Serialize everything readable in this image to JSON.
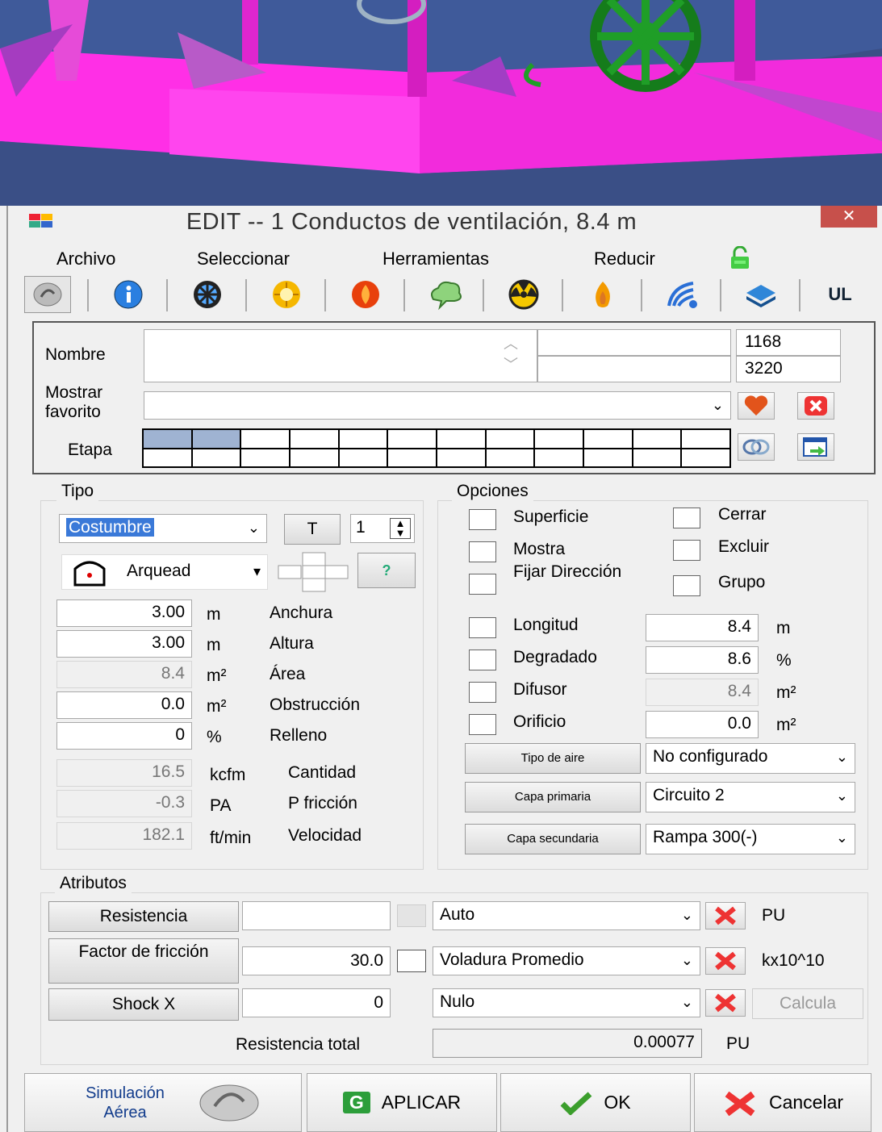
{
  "window": {
    "title": "EDIT -- 1 Conductos de ventilación, 8.4 m",
    "close": "✕"
  },
  "menu": [
    "Archivo",
    "Seleccionar",
    "Herramientas",
    "Reducir"
  ],
  "toolbar_icons": [
    "simulacion-icon",
    "info-icon",
    "fan-icon",
    "sun-icon",
    "fire-icon",
    "cloud-icon",
    "radiation-icon",
    "flame-icon",
    "signal-icon",
    "layers-icon",
    "ul-icon"
  ],
  "toolbar_ul": "UL",
  "header": {
    "nombre_label": "Nombre",
    "nombre_value": "",
    "id1": "1168",
    "id2": "3220",
    "favorito_label": "Mostrar favorito",
    "favorito_value": "",
    "etapa_label": "Etapa",
    "etapa_cells": 12,
    "etapa_selected": 2
  },
  "tipo": {
    "legend": "Tipo",
    "type_value": "Costumbre",
    "t_button": "T",
    "spinner_value": "1",
    "shape_value": "Arquead",
    "help": "?",
    "rows": [
      {
        "value": "3.00",
        "unit": "m",
        "label": "Anchura",
        "editable": true
      },
      {
        "value": "3.00",
        "unit": "m",
        "label": "Altura",
        "editable": true
      },
      {
        "value": "8.4",
        "unit": "m²",
        "label": "Área",
        "editable": false
      },
      {
        "value": "0.0",
        "unit": "m²",
        "label": "Obstrucción",
        "editable": true
      },
      {
        "value": "0",
        "unit": "%",
        "label": "Relleno",
        "editable": true
      }
    ],
    "calc": [
      {
        "value": "16.5",
        "unit": "kcfm",
        "label": "Cantidad"
      },
      {
        "value": "-0.3",
        "unit": "PA",
        "label": "P fricción"
      },
      {
        "value": "182.1",
        "unit": "ft/min",
        "label": "Velocidad"
      }
    ]
  },
  "opciones": {
    "legend": "Opciones",
    "checks_left": [
      "Superficie",
      "Mostra",
      "Fijar Dirección"
    ],
    "checks_right": [
      "Cerrar",
      "Excluir",
      "Grupo"
    ],
    "rows": [
      {
        "label": "Longitud",
        "value": "8.4",
        "unit": "m",
        "editable": true
      },
      {
        "label": "Degradado",
        "value": "8.6",
        "unit": "%",
        "editable": true
      },
      {
        "label": "Difusor",
        "value": "8.4",
        "unit": "m²",
        "editable": false
      },
      {
        "label": "Orificio",
        "value": "0.0",
        "unit": "m²",
        "editable": true
      }
    ],
    "combos": [
      {
        "button": "Tipo de aire",
        "value": "No configurado"
      },
      {
        "button": "Capa primaria",
        "value": "Circuito 2"
      },
      {
        "button": "Capa secundaria",
        "value": "Rampa 300(-)"
      }
    ]
  },
  "atributos": {
    "legend": "Atributos",
    "rows": [
      {
        "button": "Resistencia",
        "value": "",
        "combo": "Auto",
        "unit": "PU"
      },
      {
        "button": "Factor de fricción",
        "value": "30.0",
        "combo": "Voladura Promedio",
        "unit": "kx10^10"
      },
      {
        "button": "Shock X",
        "value": "0",
        "combo": "Nulo",
        "unit": ""
      }
    ],
    "calcula": "Calcula",
    "total_label": "Resistencia total",
    "total_value": "0.00077",
    "total_unit": "PU"
  },
  "footer": {
    "sim_label": "Simulación Aérea",
    "aplicar": "APLICAR",
    "ok": "OK",
    "cancelar": "Cancelar",
    "aplicar_icon_letter": "G"
  }
}
